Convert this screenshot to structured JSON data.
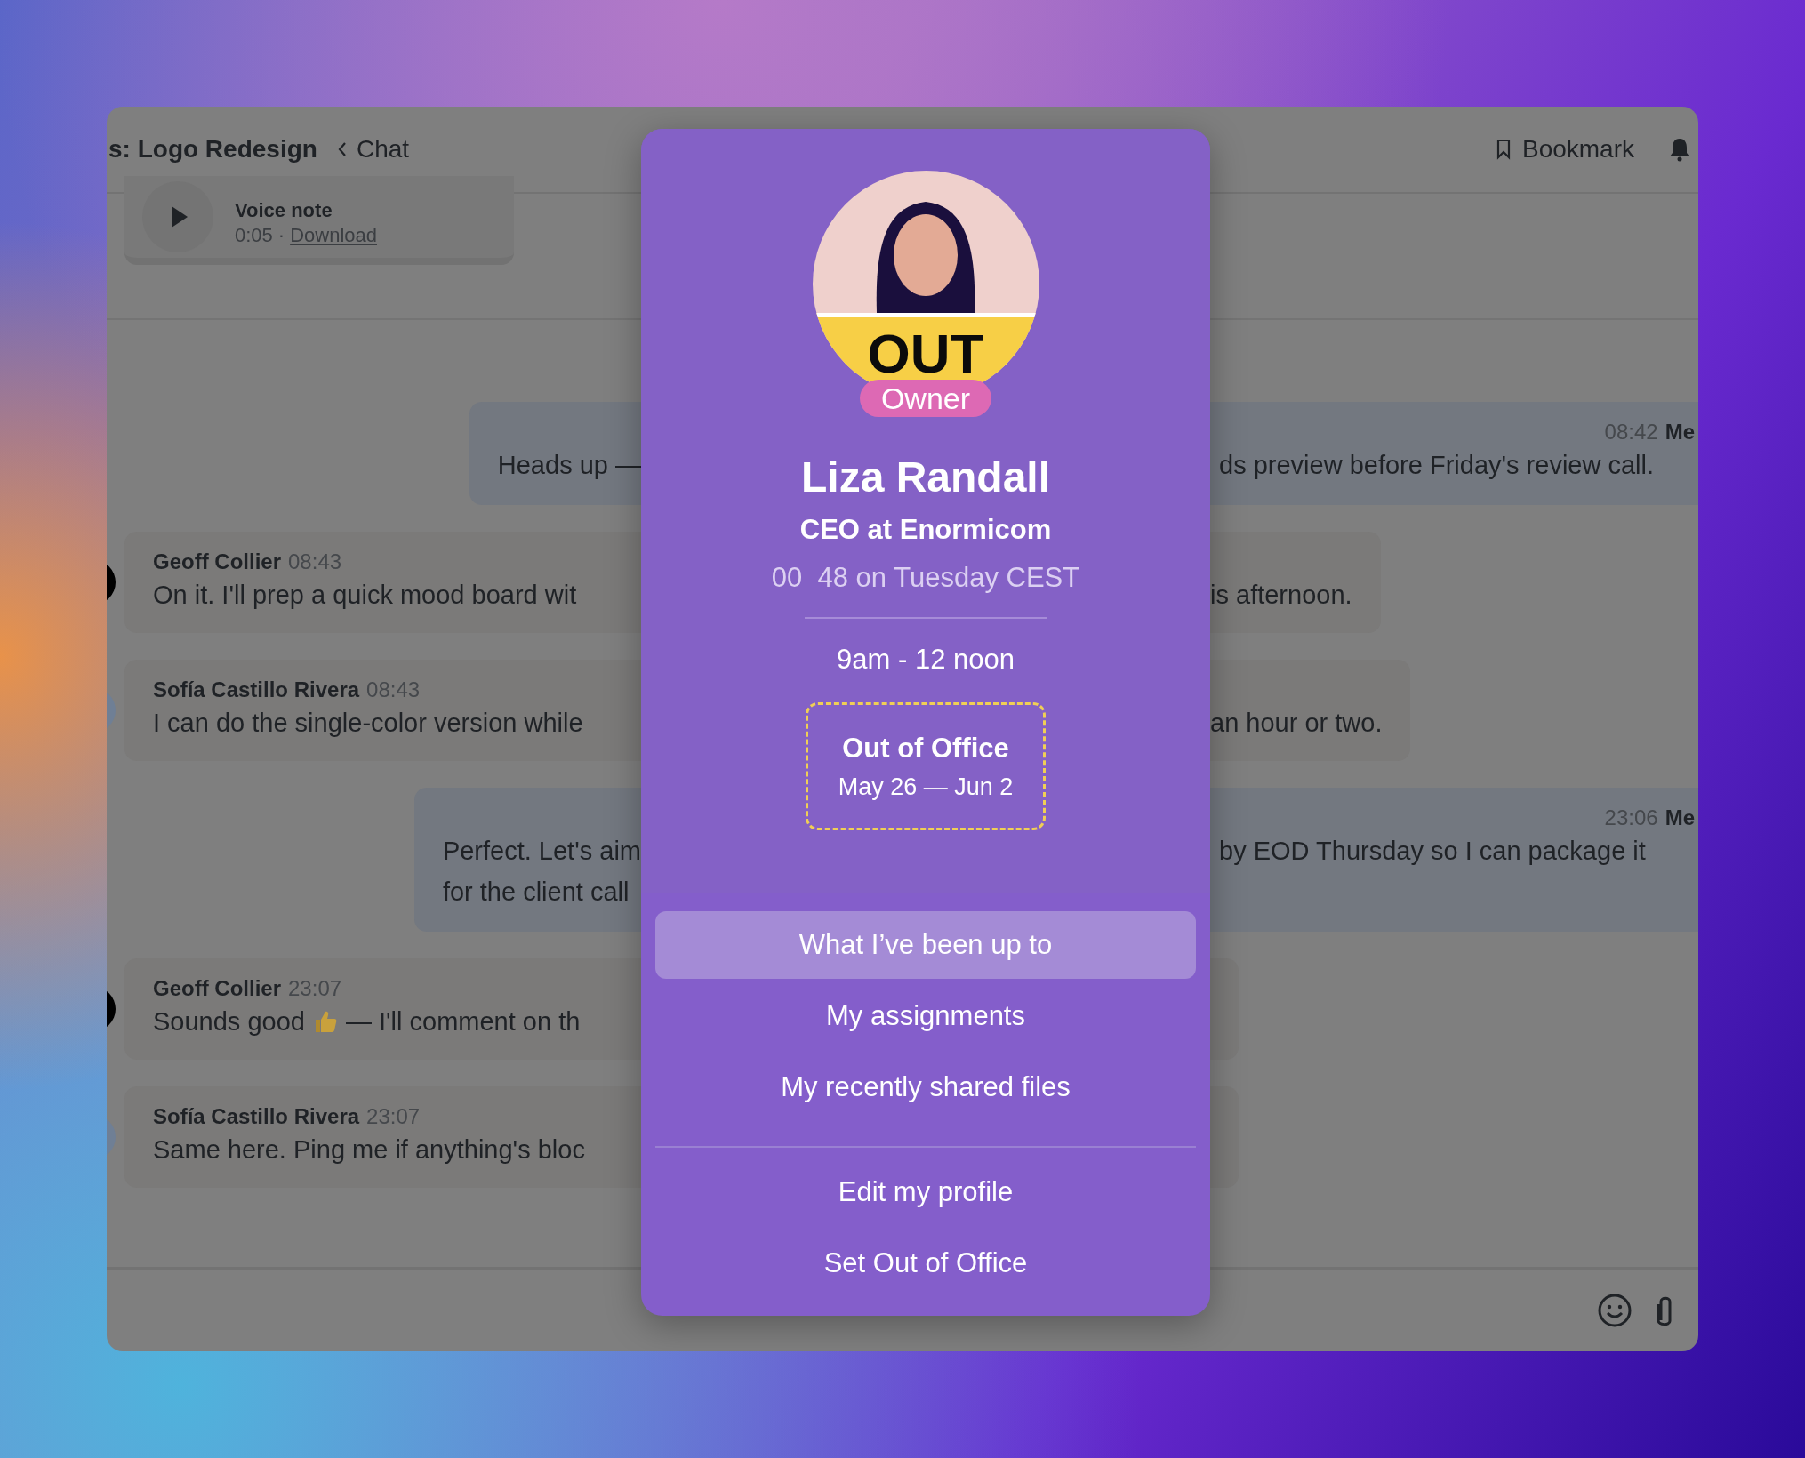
{
  "header": {
    "title": "s: Logo Redesign",
    "back_label": "Chat",
    "bookmark_label": "Bookmark"
  },
  "voice_note": {
    "title": "Voice note",
    "duration": "0:05",
    "separator": "·",
    "download_link": "Download"
  },
  "messages": [
    {
      "kind": "outgoing",
      "time": "08:42",
      "author": "Me",
      "lines": [
        {
          "start": "Heads up — ",
          "end": "ds preview before Friday's review call."
        }
      ]
    },
    {
      "kind": "incoming",
      "author": "Geoff Collier",
      "time": "08:43",
      "color": "#000000",
      "lines": [
        {
          "start": "On it. I'll prep a quick mood board wit",
          "end": "is afternoon."
        }
      ]
    },
    {
      "kind": "incoming",
      "author": "Sofía Castillo Rivera",
      "time": "08:43",
      "color": "#6f7f95",
      "lines": [
        {
          "start": "I can do the single-color version while",
          "end": "an hour or two."
        }
      ]
    },
    {
      "kind": "outgoing",
      "time": "23:06",
      "author": "Me",
      "lines": [
        {
          "start": "Perfect. Let's aim",
          "end": "by EOD Thursday so I can package it"
        },
        {
          "start": "for the client call"
        }
      ]
    },
    {
      "kind": "incoming",
      "author": "Geoff Collier",
      "time": "23:07",
      "color": "#000000",
      "lines": [
        {
          "start": "Sounds good",
          "emoji": true,
          "rest": "— I'll comment on th"
        }
      ]
    },
    {
      "kind": "incoming",
      "author": "Sofía Castillo Rivera",
      "time": "23:07",
      "color": "#6f7f95",
      "lines": [
        {
          "start": "Same here. Ping me if anything's bloc"
        }
      ]
    }
  ],
  "profile": {
    "avatar_badge": "OUT",
    "role": "Owner",
    "name": "Liza Randall",
    "title": "CEO at Enormicom",
    "local_time": "00  48 on Tuesday CEST",
    "hours": "9am - 12 noon",
    "out_of_office": {
      "title": "Out of Office",
      "dates": "May 26 — Jun 2"
    },
    "menu": [
      {
        "label": "What I’ve been up to",
        "selected": true
      },
      {
        "label": "My assignments",
        "selected": false
      },
      {
        "label": "My recently shared files",
        "selected": false
      }
    ],
    "actions": [
      {
        "label": "Edit my profile"
      },
      {
        "label": "Set Out of Office"
      }
    ]
  }
}
